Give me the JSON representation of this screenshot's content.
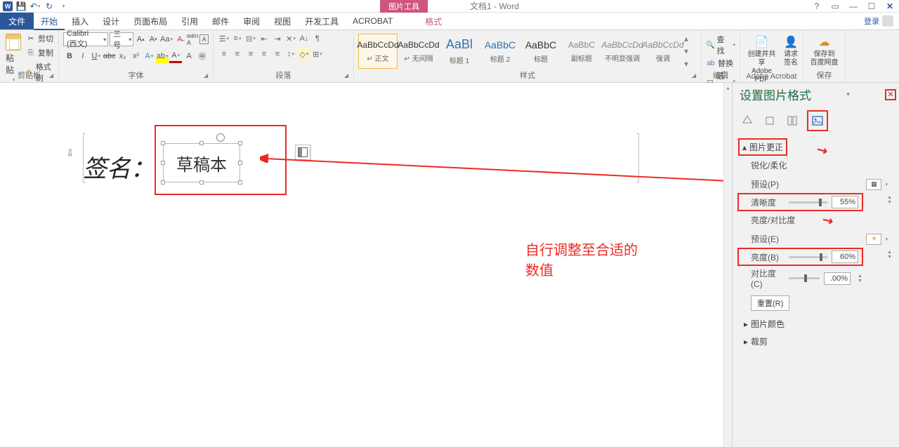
{
  "titlebar": {
    "pictools": "图片工具",
    "doc_title": "文档1 - Word",
    "help": "?",
    "login": "登录"
  },
  "tabs": {
    "file": "文件",
    "home": "开始",
    "insert": "插入",
    "design": "设计",
    "layout": "页面布局",
    "refs": "引用",
    "mail": "邮件",
    "review": "审阅",
    "view": "视图",
    "dev": "开发工具",
    "acrobat": "ACROBAT",
    "format": "格式"
  },
  "ribbon": {
    "clipboard": {
      "label": "剪贴板",
      "paste": "粘贴",
      "cut": "剪切",
      "copy": "复制",
      "fmt": "格式刷"
    },
    "font": {
      "label": "字体",
      "name": "Calibri (西文)",
      "size": "三号"
    },
    "para": {
      "label": "段落"
    },
    "styles": {
      "label": "样式",
      "items": [
        {
          "sample": "AaBbCcDd",
          "name": "↵ 正文"
        },
        {
          "sample": "AaBbCcDd",
          "name": "↵ 无间隔"
        },
        {
          "sample": "AaBl",
          "name": "标题 1"
        },
        {
          "sample": "AaBbC",
          "name": "标题 2"
        },
        {
          "sample": "AaBbC",
          "name": "标题"
        },
        {
          "sample": "AaBbC",
          "name": "副标题"
        },
        {
          "sample": "AaBbCcDd",
          "name": "不明显强调"
        },
        {
          "sample": "AaBbCcDd",
          "name": "强调"
        }
      ]
    },
    "edit": {
      "label": "编辑",
      "find": "查找",
      "replace": "替换",
      "select": "选择"
    },
    "adobe": {
      "label": "Adobe Acrobat",
      "create": "创建并共享",
      "create2": "Adobe PDF",
      "sign": "请求",
      "sign2": "签名"
    },
    "save": {
      "label": "保存",
      "baidu": "保存到",
      "baidu2": "百度网盘"
    }
  },
  "doc": {
    "signature": "签名：",
    "handwriting": "草稿本"
  },
  "annot": {
    "tip": "自行调整至合适的数值"
  },
  "panel": {
    "title": "设置图片格式",
    "section_correction": "图片更正",
    "sharpen_soft": "锐化/柔化",
    "preset_p": "预设(P)",
    "sharpness": "清晰度",
    "sharpness_val": "55%",
    "bright_contrast": "亮度/对比度",
    "preset_e": "预设(E)",
    "brightness": "亮度(B)",
    "brightness_val": "60%",
    "contrast": "对比度(C)",
    "contrast_val": ".00%",
    "reset": "重置(R)",
    "pic_color": "图片颜色",
    "crop": "裁剪"
  }
}
